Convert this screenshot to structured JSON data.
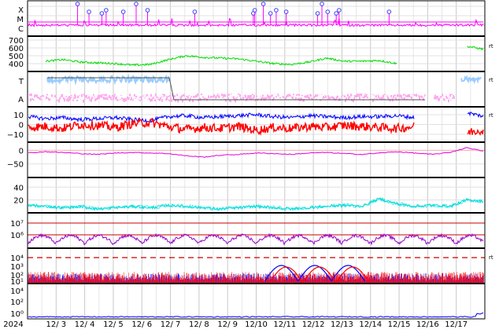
{
  "chart_data": {
    "type": "line",
    "x_axis": {
      "start": "2024-12-02",
      "ticks": [
        "2024",
        "12/ 3",
        "12/ 4",
        "12/ 5",
        "12/ 6",
        "12/ 7",
        "12/ 8",
        "12/ 9",
        "12/10",
        "12/11",
        "12/12",
        "12/13",
        "12/14",
        "12/15",
        "12/16",
        "12/17"
      ]
    },
    "panels": [
      {
        "name": "flare-class",
        "ylabels": [
          "X",
          "M",
          "C"
        ],
        "color": "#ff00ff",
        "marker_color": "#4040ff",
        "events_day": [
          3.75,
          4.15,
          4.6,
          4.75,
          5.35,
          5.8,
          6.2,
          7.85,
          9.9,
          9.95,
          10.25,
          10.5,
          10.7,
          11.05,
          12.15,
          12.3,
          12.5,
          12.8,
          12.9,
          14.65
        ]
      },
      {
        "name": "solar-wind-speed",
        "ylabels": [
          "700",
          "600",
          "500",
          "400"
        ],
        "ylim": [
          300,
          750
        ],
        "color": "#00dd00",
        "right_label": "rt",
        "series": [
          {
            "values": [
              null,
              430,
              450,
              420,
              410,
              400,
              380,
              390,
              450,
              500,
              480,
              470,
              460,
              430,
              400,
              390,
              420,
              470,
              430,
              430,
              440,
              400,
              null,
              null,
              null,
              620,
              580
            ]
          }
        ]
      },
      {
        "name": "imf-temperature",
        "ylabels": [
          "T",
          "A"
        ],
        "right_label": "rt",
        "series": [
          {
            "name": "T",
            "color": "#99ccff"
          },
          {
            "name": "A",
            "color": "#ffaaee"
          }
        ],
        "step_line_color": "#555555"
      },
      {
        "name": "bz",
        "ylabels": [
          "10",
          "0",
          "−10"
        ],
        "ylim": [
          -18,
          18
        ],
        "right_label": "rt",
        "series": [
          {
            "color": "#0000ff",
            "values": [
              8,
              6,
              7,
              5,
              6,
              7,
              5,
              4,
              8,
              9,
              7,
              8,
              9,
              10,
              8,
              7,
              9,
              8,
              7,
              8,
              8,
              9,
              7,
              null,
              null,
              12,
              8
            ]
          },
          {
            "color": "#ff0000",
            "values": [
              -3,
              -2,
              -4,
              0,
              -1,
              -3,
              1,
              2,
              -2,
              -5,
              -3,
              -4,
              -2,
              -6,
              -3,
              -4,
              -2,
              -3,
              -1,
              -2,
              -3,
              -4,
              -2,
              null,
              null,
              -8,
              -5
            ]
          }
        ]
      },
      {
        "name": "dst",
        "ylabels": [
          "0",
          "−50"
        ],
        "ylim": [
          -100,
          30
        ],
        "color": "#dd00dd",
        "series": [
          {
            "values": [
              -10,
              -5,
              -8,
              -12,
              -15,
              -10,
              -8,
              -10,
              -12,
              -20,
              -25,
              -18,
              -15,
              -10,
              -12,
              -15,
              -10,
              -8,
              -12,
              -15,
              -10,
              -5,
              -10,
              -15,
              -8,
              10,
              -5
            ]
          }
        ]
      },
      {
        "name": "kp",
        "ylabels": [
          "40",
          "20"
        ],
        "ylim": [
          0,
          55
        ],
        "color": "#00dddd",
        "series": [
          {
            "values": [
              12,
              10,
              8,
              10,
              6,
              8,
              10,
              8,
              12,
              10,
              8,
              6,
              8,
              10,
              8,
              6,
              8,
              10,
              12,
              10,
              22,
              14,
              10,
              12,
              10,
              20,
              18
            ]
          }
        ]
      },
      {
        "name": "electron-flux",
        "ylabels": [
          "10⁷",
          "10⁶"
        ],
        "color": "#9900cc",
        "threshold_color": "#cc0000"
      },
      {
        "name": "proton-flux",
        "ylabels": [
          "10⁴",
          "10³",
          "10²",
          "10¹"
        ],
        "right_label": "rt",
        "series": [
          {
            "color": "#0000ff"
          },
          {
            "color": "#ff0000"
          }
        ],
        "dashed_threshold_color": "#cc0000"
      },
      {
        "name": "neutron",
        "ylabels": [
          "10⁴",
          "10²",
          "10⁰"
        ],
        "color": "#0000ff"
      }
    ]
  }
}
